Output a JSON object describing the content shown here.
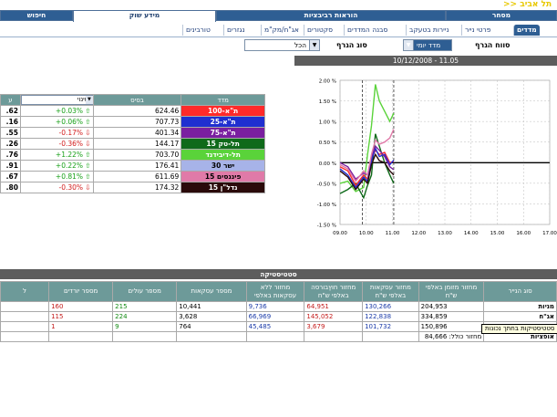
{
  "brand": ">> תל אביב",
  "tabs": [
    {
      "label": "מסחר",
      "active": false
    },
    {
      "label": "הוראות רביבציות",
      "active": false
    },
    {
      "label": "מידע שוק",
      "active": true
    },
    {
      "label": "חיפוש",
      "active": false
    }
  ],
  "subtabs": [
    "מדדים",
    "פרטי נייר",
    "ניירות בטעקב",
    "סבנה המדדים",
    "סקטורים",
    "אג\"ח/מק\"מ",
    "נגזרים",
    "טורבינים"
  ],
  "filters": {
    "index_type_label": "סווח הגרף",
    "index_type_value": "מדד יומי",
    "graph_type_label": "סוג הגרף",
    "graph_type_value": "הכל"
  },
  "datebar": "10/12/2008 - 11.05",
  "index_table": {
    "headers": {
      "name": "מדד",
      "base": "בסיס",
      "change": "שינוי",
      "extra": "ע"
    },
    "rows": [
      {
        "name": "ת\"א-100",
        "color": "#ff2a2a",
        "text_color": "#fff",
        "base": "624.46",
        "change": "+0.03%",
        "dir": "up",
        "extra": ".62"
      },
      {
        "name": "ת\"א-25",
        "color": "#1f2fd0",
        "text_color": "#fff",
        "base": "707.73",
        "change": "+0.06%",
        "dir": "up",
        "extra": ".16"
      },
      {
        "name": "ת\"א-75",
        "color": "#7a1fa0",
        "text_color": "#fff",
        "base": "401.34",
        "change": "-0.17%",
        "dir": "down",
        "extra": ".55"
      },
      {
        "name": "תל-טק 15",
        "color": "#0f6a1a",
        "text_color": "#fff",
        "base": "144.17",
        "change": "-0.36%",
        "dir": "down",
        "extra": ".26"
      },
      {
        "name": "תל-דיבידנד",
        "color": "#5ad33a",
        "text_color": "#fff",
        "base": "703.70",
        "change": "+1.22%",
        "dir": "up",
        "extra": ".76"
      },
      {
        "name": "ישר 30",
        "color": "#a7b3e8",
        "text_color": "#000",
        "base": "176.41",
        "change": "+0.22%",
        "dir": "up",
        "extra": ".91"
      },
      {
        "name": "פיננסים 15",
        "color": "#e07aa8",
        "text_color": "#000",
        "base": "611.69",
        "change": "+0.81%",
        "dir": "up",
        "extra": ".67"
      },
      {
        "name": "נדל\"ן 15",
        "color": "#2a0a0a",
        "text_color": "#fff",
        "base": "174.32",
        "change": "-0.30%",
        "dir": "down",
        "extra": ".80"
      }
    ]
  },
  "chart_data": {
    "type": "line",
    "x_ticks": [
      "09.00",
      "10.00",
      "11.00",
      "12.00",
      "13.00",
      "14.00",
      "15.00",
      "16.00",
      "17.00"
    ],
    "y_ticks": [
      "2.00 %",
      "1.50 %",
      "1.00 %",
      "0.50 %",
      "0.00 %",
      "-0.50 %",
      "-1.00 %",
      "-1.50 %"
    ],
    "ylim": [
      -1.5,
      2.0
    ],
    "xlim": [
      9.0,
      17.0
    ],
    "series": [
      {
        "color": "#5ad33a",
        "x": [
          9.0,
          9.3,
          9.6,
          9.9,
          10.05,
          10.2,
          10.35,
          10.5,
          10.7,
          10.9,
          11.05
        ],
        "y": [
          -0.5,
          -0.45,
          -0.7,
          -0.6,
          0.2,
          0.9,
          1.9,
          1.5,
          1.25,
          1.0,
          1.2
        ]
      },
      {
        "color": "#0f6a1a",
        "x": [
          9.0,
          9.3,
          9.6,
          9.9,
          10.05,
          10.2,
          10.35,
          10.5,
          10.7,
          10.9,
          11.05
        ],
        "y": [
          -0.75,
          -0.65,
          -0.5,
          -0.85,
          -0.55,
          -0.3,
          0.7,
          0.4,
          0.0,
          -0.3,
          -0.5
        ]
      },
      {
        "color": "#ff2a2a",
        "x": [
          9.0,
          9.3,
          9.6,
          9.9,
          10.05,
          10.2,
          10.35,
          10.5,
          10.7,
          10.9,
          11.05
        ],
        "y": [
          -0.1,
          -0.2,
          -0.55,
          -0.3,
          -0.4,
          0.1,
          0.3,
          0.2,
          0.25,
          0.0,
          0.03
        ]
      },
      {
        "color": "#1f2fd0",
        "x": [
          9.0,
          9.3,
          9.6,
          9.9,
          10.05,
          10.2,
          10.35,
          10.5,
          10.7,
          10.9,
          11.05
        ],
        "y": [
          -0.15,
          -0.3,
          -0.6,
          -0.35,
          -0.45,
          0.05,
          0.35,
          0.15,
          0.2,
          -0.05,
          0.06
        ]
      },
      {
        "color": "#7a1fa0",
        "x": [
          9.0,
          9.3,
          9.6,
          9.9,
          10.05,
          10.2,
          10.35,
          10.5,
          10.7,
          10.9,
          11.05
        ],
        "y": [
          0.0,
          -0.1,
          -0.4,
          -0.25,
          -0.3,
          0.15,
          0.4,
          0.3,
          0.15,
          -0.1,
          -0.17
        ]
      },
      {
        "color": "#e07aa8",
        "x": [
          9.0,
          9.3,
          9.6,
          9.9,
          10.05,
          10.2,
          10.35,
          10.5,
          10.7,
          10.9,
          11.05
        ],
        "y": [
          -0.05,
          -0.15,
          -0.45,
          -0.2,
          -0.3,
          0.2,
          0.55,
          0.45,
          0.5,
          0.6,
          0.81
        ]
      },
      {
        "color": "#2a0a0a",
        "x": [
          9.0,
          9.3,
          9.6,
          9.9,
          10.05,
          10.2,
          10.35,
          10.5,
          10.7,
          10.9,
          11.05
        ],
        "y": [
          -0.2,
          -0.35,
          -0.65,
          -0.4,
          -0.5,
          -0.05,
          0.2,
          0.05,
          0.0,
          -0.2,
          -0.3
        ]
      }
    ]
  },
  "stat_title": "סטטיסטיקה",
  "stat_table": {
    "headers": [
      "סוג הנייר",
      "מחזור מזומן באלפי ש\"ח",
      "מחזור עסקאות באלפי ש\"ח",
      "מחזור חוץבורסה באלפי ש\"ח",
      "מחזור ללא עסקאות באלפי",
      "מספר עסקאות",
      "מספר עולים",
      "מספר יורדים",
      "ל"
    ],
    "rows": [
      {
        "label": "מניות",
        "cells": [
          "204,953",
          "130,266",
          "64,951",
          "9,736",
          "10,441",
          "215",
          "160"
        ],
        "colors": [
          "",
          "b",
          "r",
          "b",
          "",
          "g",
          "r"
        ]
      },
      {
        "label": "אג\"ח",
        "cells": [
          "334,859",
          "122,838",
          "145,052",
          "66,969",
          "3,628",
          "224",
          "115"
        ],
        "colors": [
          "",
          "b",
          "r",
          "b",
          "",
          "g",
          "r"
        ]
      },
      {
        "label": "מק\"מ",
        "cells": [
          "150,896",
          "101,732",
          "3,679",
          "45,485",
          "764",
          "9",
          "1"
        ],
        "colors": [
          "",
          "b",
          "r",
          "b",
          "",
          "g",
          "r"
        ]
      },
      {
        "label": "אופציות",
        "cells": [
          "מחזור כולל: 84,666",
          "",
          "",
          "",
          "",
          "",
          ""
        ],
        "colors": [
          "",
          "",
          "",
          "",
          "",
          "",
          ""
        ]
      }
    ]
  },
  "tooltip": "סטטיסטיקות בחתך נכונות"
}
